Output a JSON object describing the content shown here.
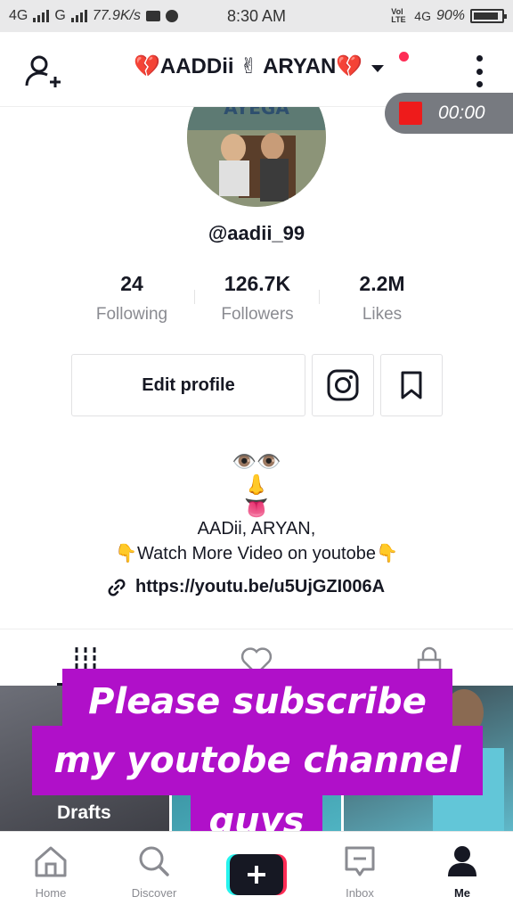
{
  "status_bar": {
    "network_left": "4G",
    "network_mid": "G",
    "speed": "77.9K/s",
    "time": "8:30 AM",
    "volte": "Vol LTE",
    "network_right": "4G",
    "battery": "90%",
    "battery_level": 0.9
  },
  "header": {
    "title": "💔AADDii ✌ ARYAN💔",
    "has_notification_dot": true
  },
  "recorder": {
    "time": "00:00"
  },
  "profile": {
    "username": "@aadii_99",
    "stats": [
      {
        "value": "24",
        "label": "Following"
      },
      {
        "value": "126.7K",
        "label": "Followers"
      },
      {
        "value": "2.2M",
        "label": "Likes"
      }
    ],
    "edit_button": "Edit profile",
    "avatar_text": "AYEGA",
    "bio": {
      "emoji_eyes": "👁️👁️",
      "emoji_nose": "👃",
      "emoji_tongue": "👅",
      "line1": "AADii, ARYAN,",
      "line2": "👇Watch More Video on youtobe👇",
      "link": "https://youtu.be/u5UjGZI006A"
    }
  },
  "videos": {
    "drafts_label": "Drafts"
  },
  "overlay": {
    "line1": "Please subscribe",
    "line2": "my youtobe channel",
    "line3": "guys",
    "color": "#b010c9"
  },
  "nav": {
    "items": [
      {
        "label": "Home",
        "icon": "home-icon"
      },
      {
        "label": "Discover",
        "icon": "search-icon"
      },
      {
        "label": "Inbox",
        "icon": "inbox-icon"
      },
      {
        "label": "Me",
        "icon": "person-icon"
      }
    ]
  }
}
